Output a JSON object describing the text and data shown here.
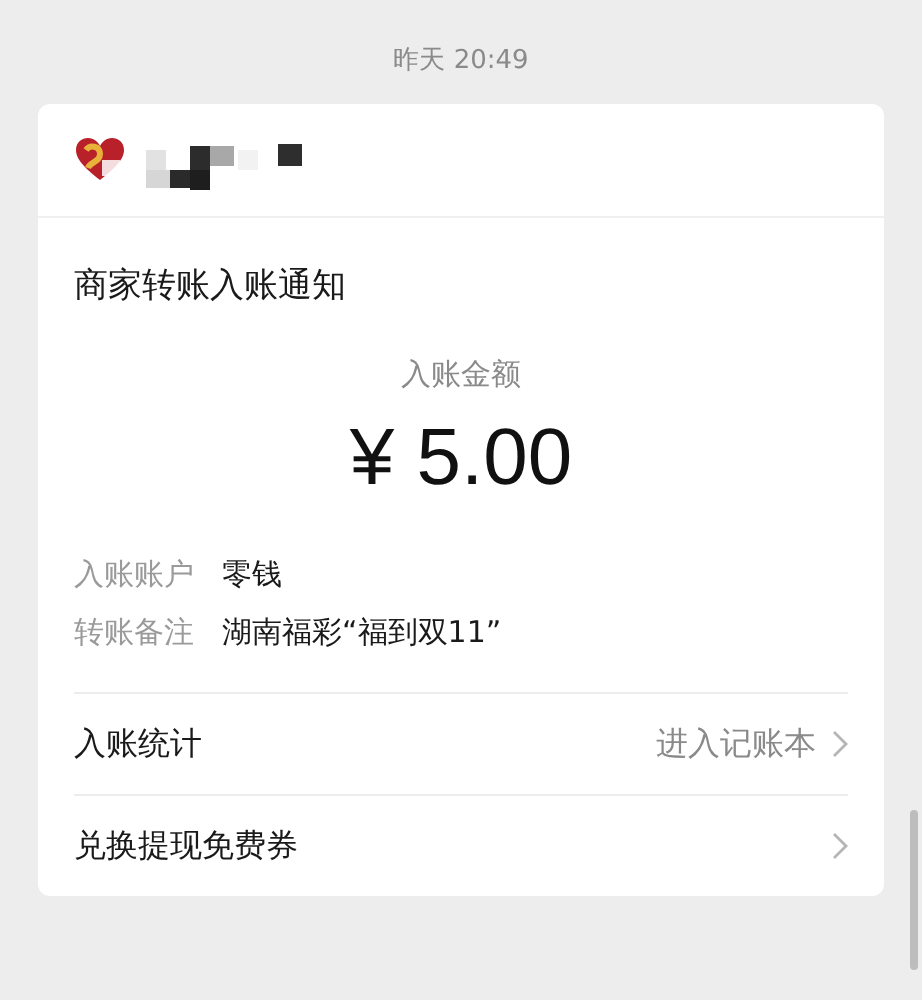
{
  "timestamp": "昨天 20:49",
  "card": {
    "title": "商家转账入账通知",
    "amount_label": "入账金额",
    "amount": "¥ 5.00",
    "details": [
      {
        "label": "入账账户",
        "value": "零钱"
      },
      {
        "label": "转账备注",
        "value": "湖南福彩“福到双11”"
      }
    ],
    "actions": [
      {
        "label": "入账统计",
        "value": "进入记账本"
      },
      {
        "label": "兑换提现免费券"
      }
    ]
  }
}
